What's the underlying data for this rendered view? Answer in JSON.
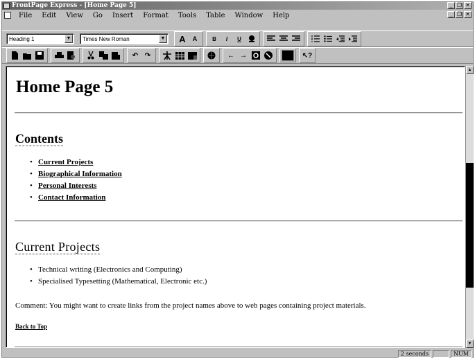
{
  "window": {
    "title": "FrontPage Express - [Home Page 5]"
  },
  "window_controls": [
    "_",
    "❐",
    "✕"
  ],
  "menu": [
    "File",
    "Edit",
    "View",
    "Go",
    "Insert",
    "Format",
    "Tools",
    "Table",
    "Window",
    "Help"
  ],
  "format_toolbar": {
    "style_value": "Heading 1",
    "font_value": "Times New Roman",
    "grow_font": "A",
    "shrink_font": "A",
    "bold": "B",
    "italic": "I",
    "underline": "U"
  },
  "document": {
    "title": "Home Page 5",
    "contents_heading": "Contents",
    "contents_links": [
      "Current Projects",
      "Biographical Information",
      "Personal Interests",
      "Contact Information"
    ],
    "projects_heading": "Current Projects",
    "projects_items": [
      "Technical writing (Electronics and Computing)",
      "Specialised Typesetting (Mathematical, Electronic etc.)"
    ],
    "comment": "Comment: You might want to create links from the project names above to web pages containing project materials.",
    "back_to_top": "Back to Top"
  },
  "status": {
    "load_time": "2 seconds",
    "num_lock": "NUM"
  }
}
